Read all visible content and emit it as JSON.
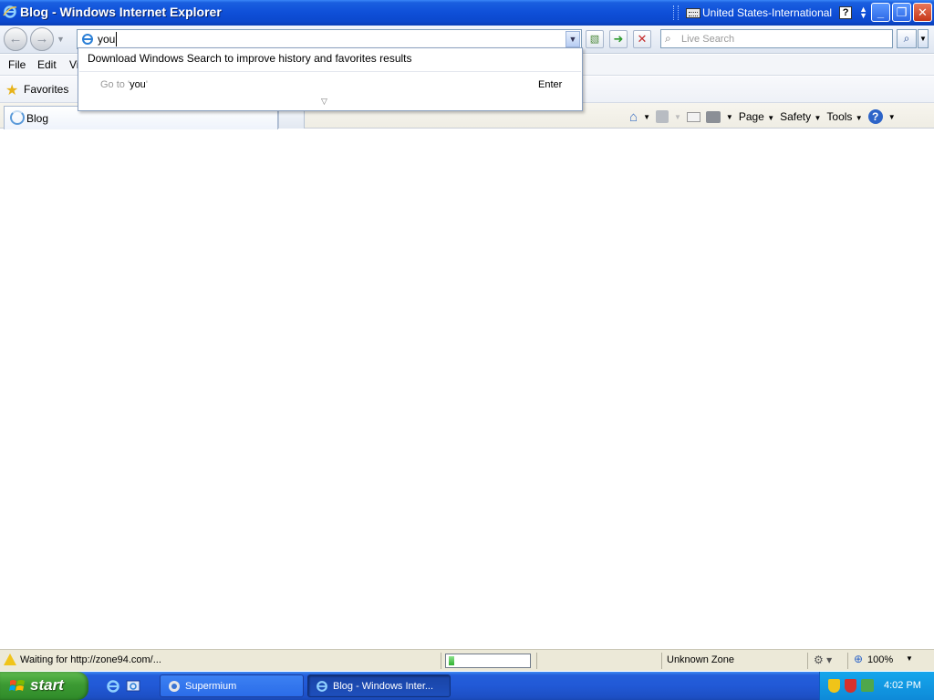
{
  "window": {
    "title": "Blog - Windows Internet Explorer",
    "language": "United States-International",
    "help_glyph": "?",
    "min_glyph": "_",
    "max_glyph": "❐",
    "close_glyph": "✕"
  },
  "nav": {
    "address_value": "you",
    "search_placeholder": "Live Search"
  },
  "menu": {
    "file": "File",
    "edit": "Edit",
    "view": "Vi"
  },
  "favorites": {
    "label": "Favorites"
  },
  "tabs": {
    "active_label": "Blog"
  },
  "command_bar": {
    "page": "Page",
    "safety": "Safety",
    "tools": "Tools"
  },
  "autocomplete": {
    "download_text": "Download Windows Search to improve history and favorites results",
    "goto_prefix": "Go to '",
    "goto_term": "you",
    "goto_suffix": "'",
    "enter_label": "Enter"
  },
  "status": {
    "text": "Waiting for http://zone94.com/...",
    "progress": 0.07,
    "zone": "Unknown Zone",
    "zoom": "100%"
  },
  "taskbar": {
    "start": "start",
    "tasks": [
      {
        "label": "Supermium"
      },
      {
        "label": "Blog - Windows Inter..."
      }
    ],
    "clock": "4:02 PM"
  },
  "icons": [
    "ie-icon",
    "keyboard-icon",
    "help-icon",
    "back-arrow-icon",
    "forward-arrow-icon",
    "page-icon",
    "dropdown-arrow-icon",
    "compatibility-icon",
    "go-arrow-icon",
    "stop-icon",
    "search-icon",
    "star-icon",
    "loading-icon",
    "home-icon",
    "feeds-icon",
    "mail-icon",
    "print-icon",
    "warning-icon",
    "protected-mode-icon",
    "zoom-icon",
    "windows-flag-icon",
    "shield-icon"
  ],
  "colors": {
    "titlebar": "#0f4fd8",
    "taskbar": "#245edb",
    "start": "#3c9a33",
    "tray": "#0e8ad8",
    "progress": "#2fb12f"
  }
}
